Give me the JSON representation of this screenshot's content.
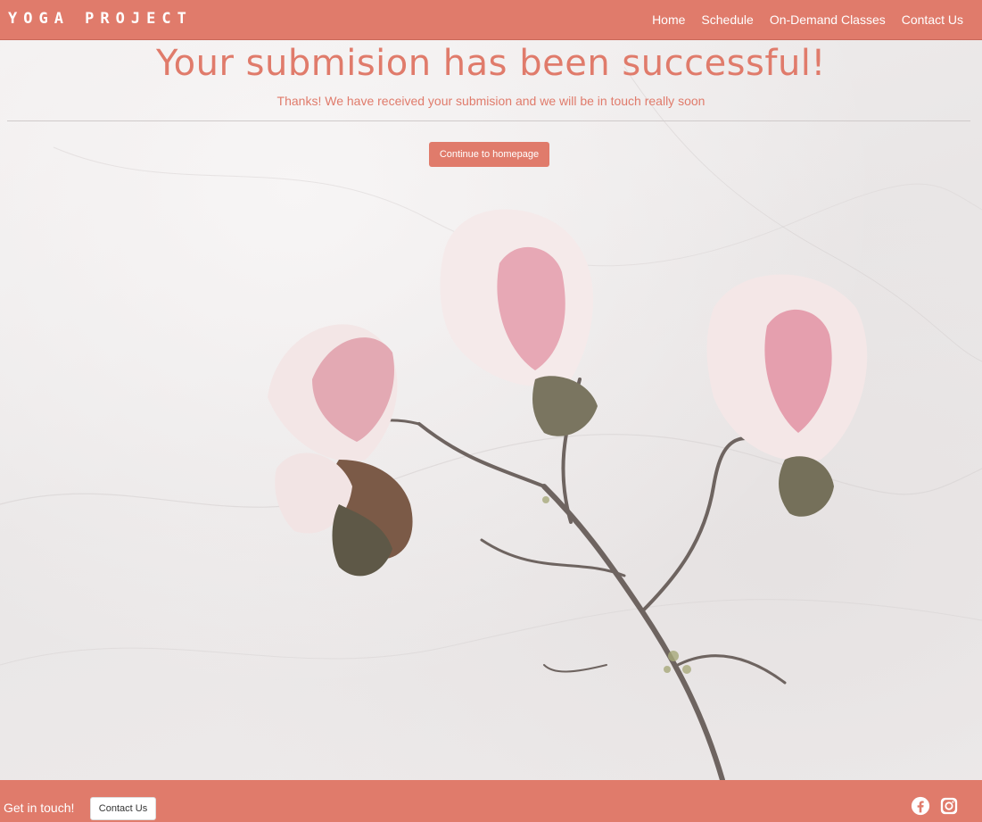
{
  "brand": {
    "name": "YOGA PROJECT"
  },
  "nav": {
    "items": [
      {
        "label": "Home"
      },
      {
        "label": "Schedule"
      },
      {
        "label": "On-Demand Classes"
      },
      {
        "label": "Contact Us"
      }
    ]
  },
  "hero": {
    "title": "Your submision has been successful!",
    "subtitle": "Thanks! We have received your submision and we will be in touch really soon",
    "button_label": "Continue to homepage"
  },
  "footer": {
    "text": "Get in touch!",
    "button_label": "Contact Us",
    "social_icons": [
      "facebook-icon",
      "instagram-icon"
    ]
  },
  "colors": {
    "brand": "#e07b6b",
    "text_light": "#ffffff"
  }
}
